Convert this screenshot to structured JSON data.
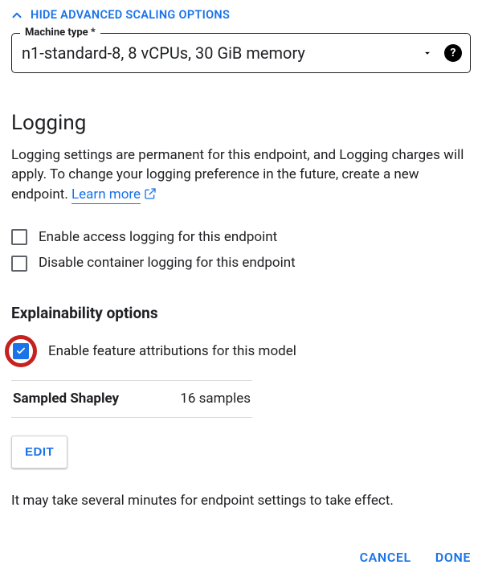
{
  "collapse": {
    "label": "HIDE ADVANCED SCALING OPTIONS"
  },
  "machine": {
    "label": "Machine type *",
    "value": "n1-standard-8, 8 vCPUs, 30 GiB memory"
  },
  "logging": {
    "heading": "Logging",
    "desc_a": "Logging settings are permanent for this endpoint, and Logging charges will apply. To change your logging preference in the future, create a new endpoint. ",
    "learn": "Learn more",
    "checks": [
      {
        "label": "Enable access logging for this endpoint",
        "checked": false
      },
      {
        "label": "Disable container logging for this endpoint",
        "checked": false
      }
    ]
  },
  "explain": {
    "heading": "Explainability options",
    "attr_label": "Enable feature attributions for this model",
    "attr_checked": true,
    "method": "Sampled Shapley",
    "samples": "16 samples",
    "edit": "EDIT"
  },
  "note": "It may take several minutes for endpoint settings to take effect.",
  "footer": {
    "cancel": "CANCEL",
    "done": "DONE"
  }
}
